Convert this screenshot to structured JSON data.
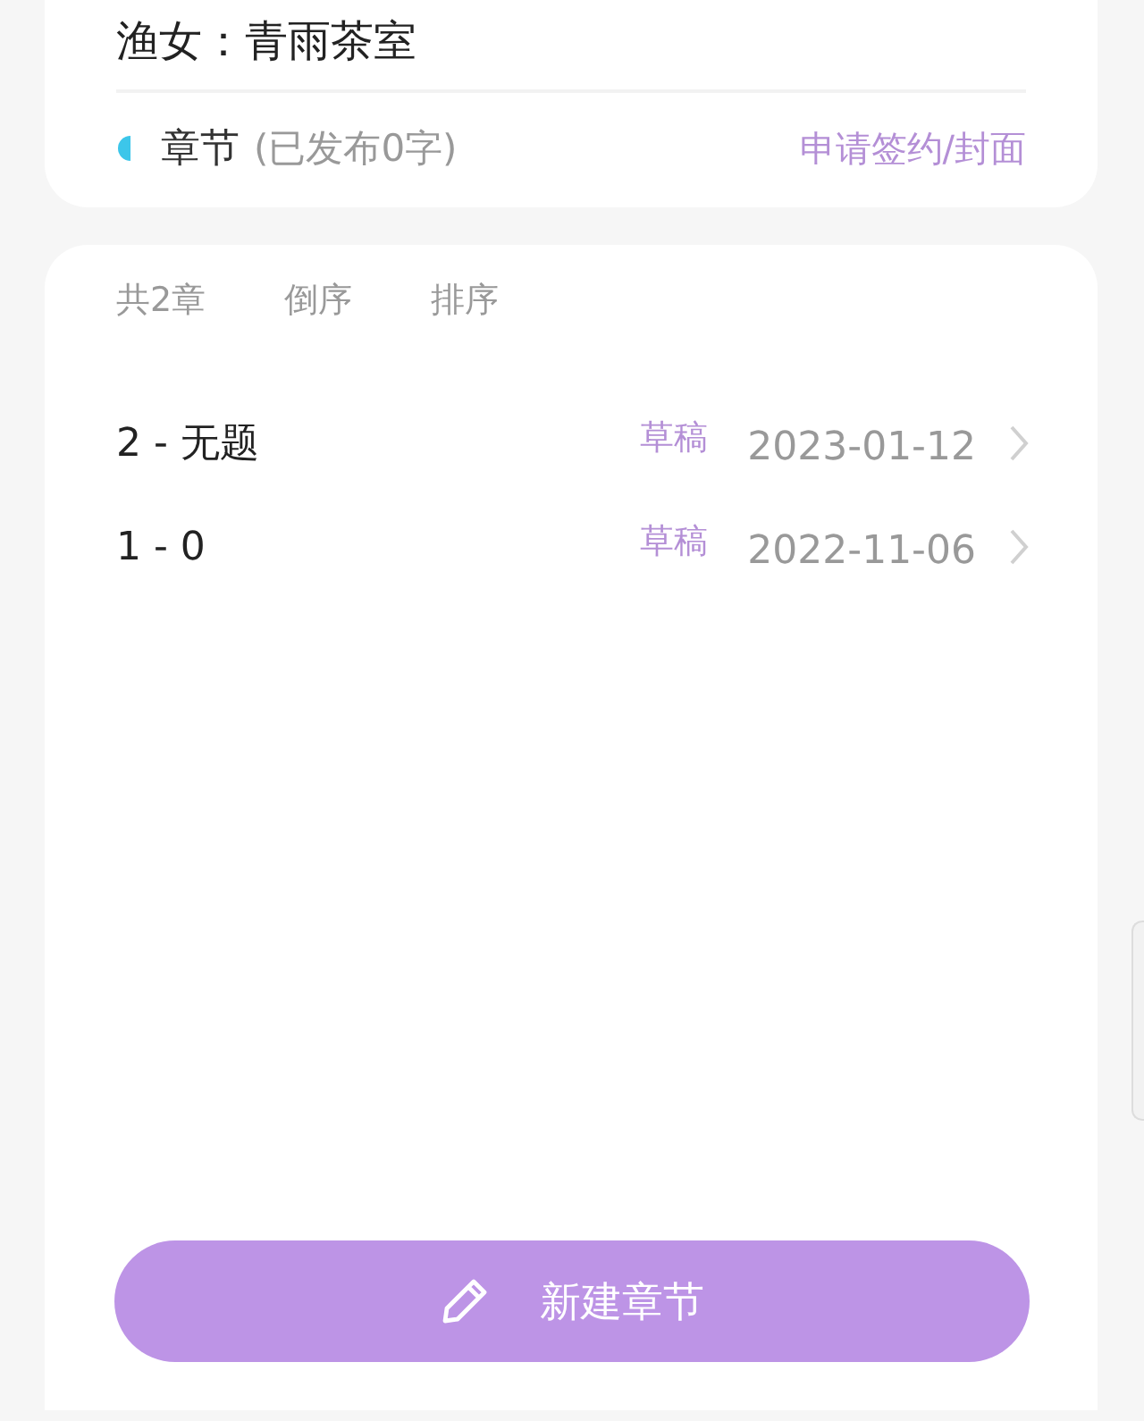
{
  "header": {
    "title": "渔女：青雨茶室",
    "section_label": "章节",
    "section_note": "(已发布0字)",
    "apply_link": "申请签约/封面"
  },
  "toolbar": {
    "count": "共2章",
    "actions": [
      "倒序",
      "排序"
    ]
  },
  "chapters": [
    {
      "title": "2 - 无题",
      "status": "草稿",
      "date": "2023-01-12"
    },
    {
      "title": "1 - 0",
      "status": "草稿",
      "date": "2022-11-06"
    }
  ],
  "new_button": {
    "label": "新建章节"
  }
}
